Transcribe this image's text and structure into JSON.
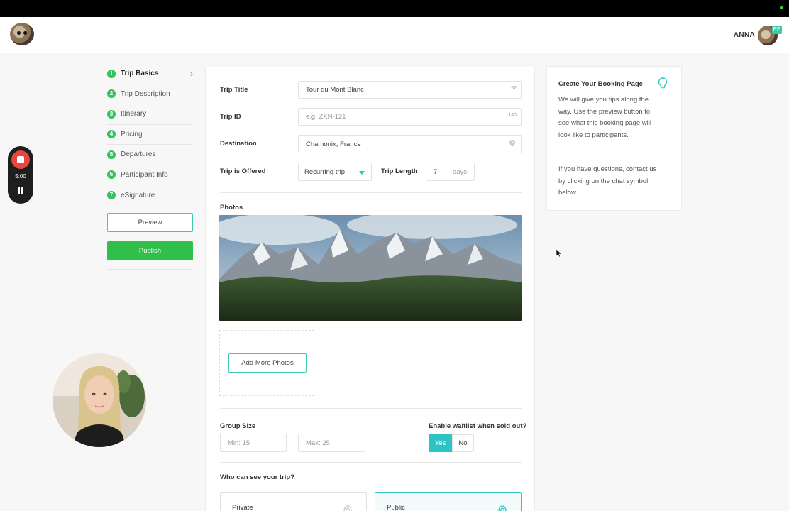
{
  "header": {
    "user_name": "ANNA",
    "badge": "EE"
  },
  "sidebar": {
    "steps": [
      {
        "num": "1",
        "label": "Trip Basics",
        "active": true
      },
      {
        "num": "2",
        "label": "Trip Description"
      },
      {
        "num": "3",
        "label": "Itinerary"
      },
      {
        "num": "4",
        "label": "Pricing"
      },
      {
        "num": "5",
        "label": "Departures"
      },
      {
        "num": "6",
        "label": "Participant Info"
      },
      {
        "num": "7",
        "label": "eSignature"
      }
    ],
    "preview_label": "Preview",
    "publish_label": "Publish"
  },
  "form": {
    "trip_title": {
      "label": "Trip Title",
      "value": "Tour du Mont Blanc",
      "counter": "52"
    },
    "trip_id": {
      "label": "Trip ID",
      "placeholder": "e.g. ZXN-121",
      "counter": "140"
    },
    "destination": {
      "label": "Destination",
      "value": "Chamonix, France"
    },
    "trip_offered": {
      "label": "Trip is Offered",
      "value": "Recurring trip"
    },
    "trip_length": {
      "label": "Trip Length",
      "value": "7",
      "unit": "days"
    },
    "photos": {
      "label": "Photos",
      "add_label": "Add More Photos"
    },
    "group_size": {
      "label": "Group Size",
      "min": "Min: 15",
      "max": "Max: 25"
    },
    "waitlist": {
      "label": "Enable waitlist when sold out?",
      "yes": "Yes",
      "no": "No",
      "selected": "Yes"
    },
    "visibility": {
      "label": "Who can see your trip?",
      "private": "Private",
      "public": "Public",
      "selected": "Public"
    }
  },
  "tips": {
    "title": "Create Your Booking Page",
    "p1": "We will give you tips along the way. Use the preview button to see what this booking page will look like to participants.",
    "p2": "If you have questions, contact us by clicking on the chat symbol below."
  },
  "recorder": {
    "time": "5:00"
  },
  "colors": {
    "accent": "#2ec4c4",
    "step_green": "#32c25e",
    "publish_green": "#2fbf4a",
    "record_red": "#e8463f"
  }
}
